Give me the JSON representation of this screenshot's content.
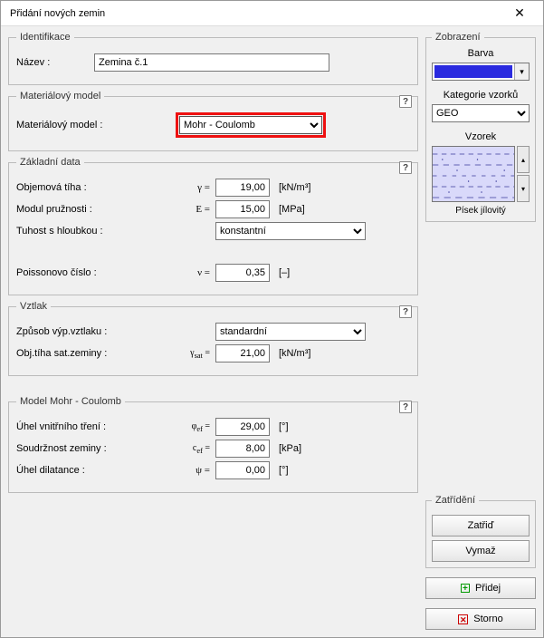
{
  "titlebar": {
    "title": "Přidání nových zemin"
  },
  "identification": {
    "legend": "Identifikace",
    "name_label": "Název :",
    "name_value": "Zemina č.1"
  },
  "material_model": {
    "legend": "Materiálový model",
    "model_label": "Materiálový model :",
    "model_value": "Mohr - Coulomb"
  },
  "basic_data": {
    "legend": "Základní data",
    "weight_label": "Objemová tíha :",
    "weight_sym": "γ =",
    "weight_value": "19,00",
    "weight_unit": "[kN/m³]",
    "modulus_label": "Modul pružnosti :",
    "modulus_sym": "E =",
    "modulus_value": "15,00",
    "modulus_unit": "[MPa]",
    "stiffness_label": "Tuhost s hloubkou :",
    "stiffness_value": "konstantní",
    "poisson_label": "Poissonovo číslo :",
    "poisson_sym": "ν =",
    "poisson_value": "0,35",
    "poisson_unit": "[–]"
  },
  "uplift": {
    "legend": "Vztlak",
    "method_label": "Způsob výp.vztlaku :",
    "method_value": "standardní",
    "sat_label": "Obj.tíha sat.zeminy :",
    "sat_sym": "γsat =",
    "sat_value": "21,00",
    "sat_unit": "[kN/m³]"
  },
  "mohr": {
    "legend": "Model Mohr - Coulomb",
    "phi_label": "Úhel vnitřního tření :",
    "phi_sym": "φef =",
    "phi_value": "29,00",
    "phi_unit": "[°]",
    "coh_label": "Soudržnost zeminy :",
    "coh_sym": "cef =",
    "coh_value": "8,00",
    "coh_unit": "[kPa]",
    "dil_label": "Úhel dilatance :",
    "dil_sym": "ψ =",
    "dil_value": "0,00",
    "dil_unit": "[°]"
  },
  "display_panel": {
    "legend": "Zobrazení",
    "color_label": "Barva",
    "color_value": "#2a2adf",
    "category_label": "Kategorie vzorků",
    "category_value": "GEO",
    "pattern_label": "Vzorek",
    "pattern_name": "Písek jílovitý"
  },
  "classify_panel": {
    "legend": "Zatřídění",
    "classify_btn": "Zatřiď",
    "delete_btn": "Vymaž"
  },
  "footer": {
    "add_btn": "Přidej",
    "cancel_btn": "Storno"
  }
}
